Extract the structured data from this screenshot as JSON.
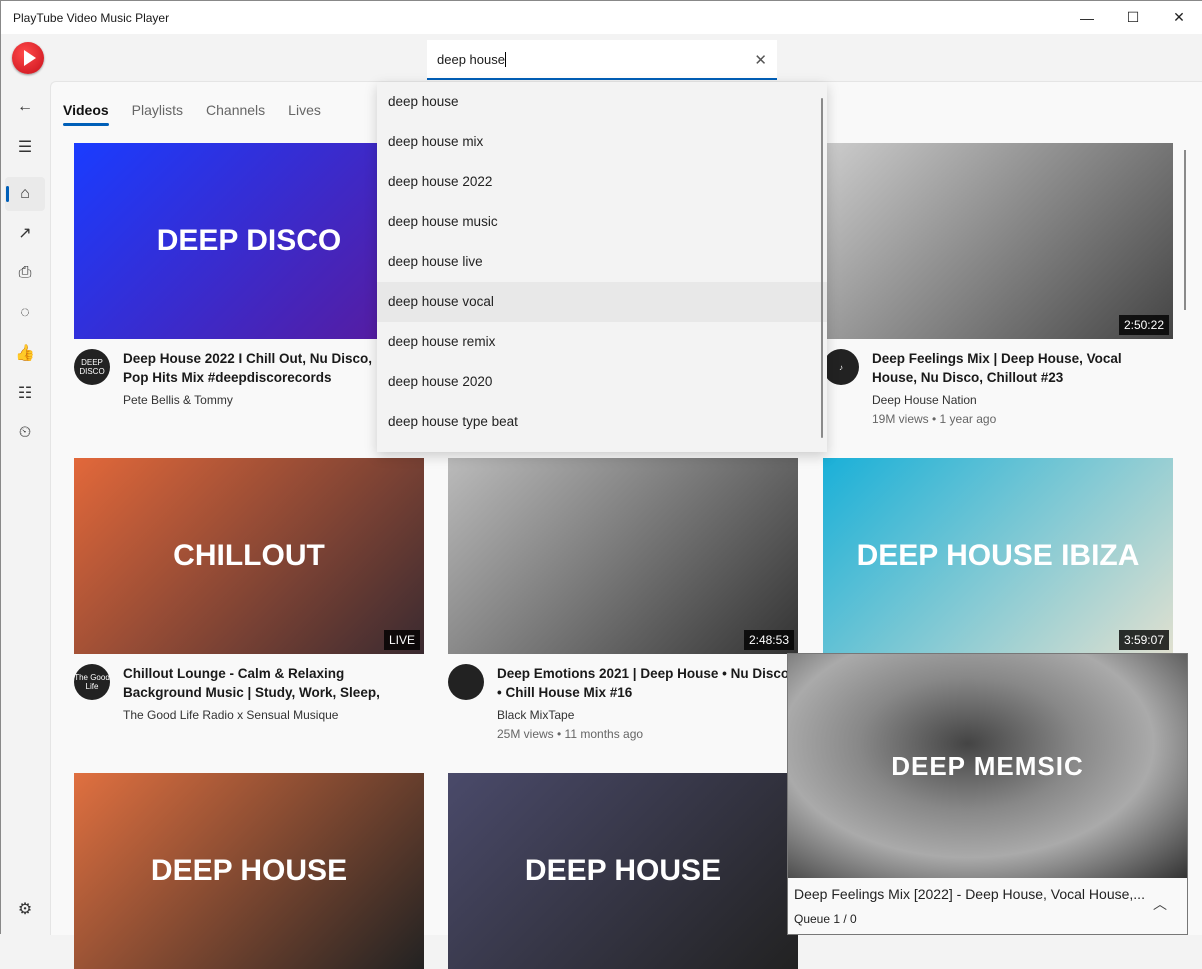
{
  "window": {
    "title": "PlayTube Video Music Player",
    "minimize": "—",
    "maximize": "☐",
    "close": "✕"
  },
  "search": {
    "value": "deep house",
    "clear": "✕"
  },
  "suggestions": [
    "deep house",
    "deep house mix",
    "deep house 2022",
    "deep house music",
    "deep house live",
    "deep house vocal",
    "deep house remix",
    "deep house 2020",
    "deep house type beat"
  ],
  "sidebar": {
    "back": "←",
    "menu": "☰",
    "home": "⌂",
    "trending": "↗",
    "subscriptions": "⎙",
    "history": "◌",
    "liked": "👍",
    "playlists": "☷",
    "watch_later": "⏲",
    "settings": "⚙"
  },
  "tabs": [
    "Videos",
    "Playlists",
    "Channels",
    "Lives"
  ],
  "videos": [
    {
      "thumb_text": "DEEP DISCO",
      "thumb_colors": [
        "#1a3cff",
        "#5a1a9a"
      ],
      "duration": "",
      "avatar": "DEEP DISCO",
      "title": "Deep House 2022 I Chill Out, Nu Disco,\nPop Hits Mix #deepdiscorecords",
      "channel": "Pete Bellis & Tommy",
      "views": ""
    },
    {
      "thumb_text": "",
      "thumb_colors": [
        "#555",
        "#333"
      ],
      "duration": "",
      "avatar": "",
      "title": "",
      "channel": "",
      "views": ""
    },
    {
      "thumb_text": "",
      "thumb_colors": [
        "#ccc",
        "#444"
      ],
      "duration": "2:50:22",
      "avatar": "♪",
      "title": "Deep Feelings Mix | Deep House, Vocal\nHouse, Nu Disco, Chillout #23",
      "channel": "Deep House Nation",
      "views": "19M views  •  1 year ago"
    },
    {
      "thumb_text": "CHILLOUT",
      "thumb_colors": [
        "#e2683a",
        "#3a2a30"
      ],
      "duration": "LIVE",
      "avatar": "The Good Life",
      "title": "Chillout Lounge - Calm & Relaxing\nBackground Music | Study, Work, Sleep,",
      "channel": "The Good Life Radio x Sensual Musique",
      "views": ""
    },
    {
      "thumb_text": "",
      "thumb_colors": [
        "#bbb",
        "#333"
      ],
      "duration": "2:48:53",
      "avatar": "",
      "title": "Deep Emotions 2021 | Deep House • Nu Disco\n• Chill House Mix #16",
      "channel": "Black MixTape",
      "views": "25M views  •  11 months ago"
    },
    {
      "thumb_text": "DEEP HOUSE IBIZA",
      "thumb_colors": [
        "#1ab0d8",
        "#e0e0d0"
      ],
      "duration": "3:59:07",
      "avatar": "",
      "title": "",
      "channel": "",
      "views": ""
    },
    {
      "thumb_text": "DEEP HOUSE",
      "thumb_colors": [
        "#e07040",
        "#222"
      ],
      "duration": "",
      "avatar": "",
      "title": "",
      "channel": "",
      "views": ""
    },
    {
      "thumb_text": "DEEP HOUSE",
      "thumb_colors": [
        "#4a4a6a",
        "#222"
      ],
      "duration": "",
      "avatar": "",
      "title": "",
      "channel": "",
      "views": ""
    }
  ],
  "mini_player": {
    "video_text": "DEEP MEMSIC",
    "title": "Deep Feelings Mix [2022] - Deep House, Vocal House,...",
    "queue": "Queue 1 / 0",
    "expand": "︿"
  },
  "colors": {
    "accent": "#005fb8",
    "logo": "#e21b24"
  }
}
